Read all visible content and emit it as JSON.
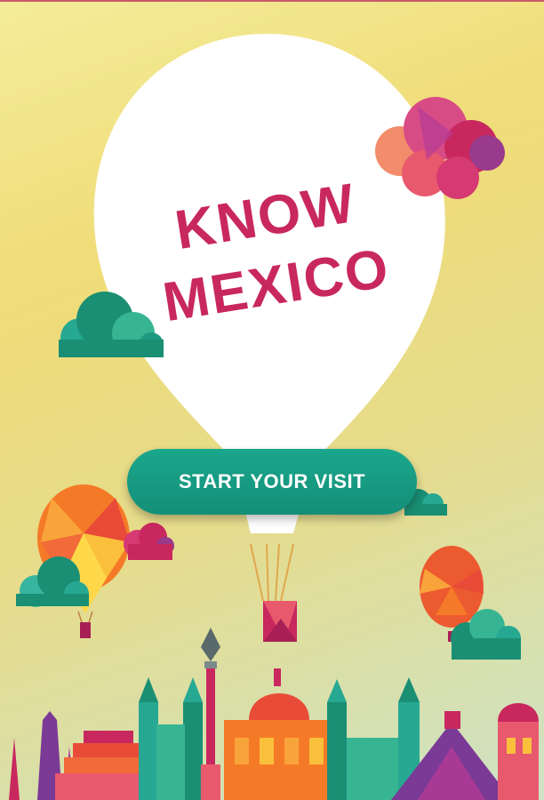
{
  "hero": {
    "title_line1": "KNOW",
    "title_line2": "MEXICO"
  },
  "actions": {
    "start_label": "START YOUR VISIT"
  },
  "colors": {
    "brand_pink": "#c8285e",
    "button_teal": "#148f78",
    "background": "#f0dc78"
  },
  "icons": [
    "hot-air-balloon-icon",
    "cloud-icon",
    "angel-monument-icon",
    "cathedral-icon",
    "pyramid-icon"
  ]
}
